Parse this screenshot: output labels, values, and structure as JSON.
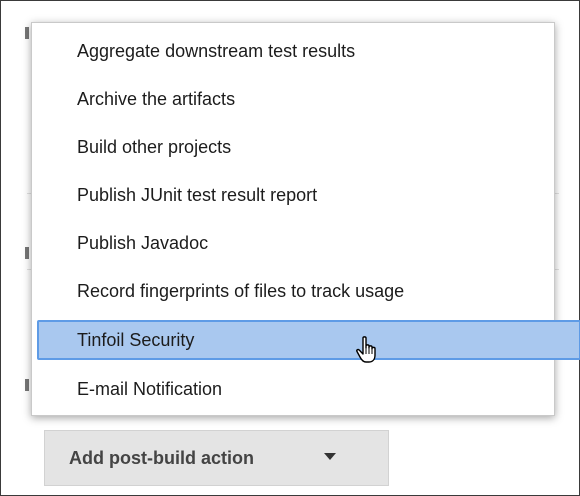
{
  "menu": {
    "items": [
      {
        "label": "Aggregate downstream test results"
      },
      {
        "label": "Archive the artifacts"
      },
      {
        "label": "Build other projects"
      },
      {
        "label": "Publish JUnit test result report"
      },
      {
        "label": "Publish Javadoc"
      },
      {
        "label": "Record fingerprints of files to track usage"
      },
      {
        "label": "Tinfoil Security",
        "selected": true
      },
      {
        "label": "E-mail Notification"
      }
    ]
  },
  "add_button": {
    "label": "Add post-build action",
    "icon": "chevron-down-icon"
  },
  "colors": {
    "selected_bg": "#a9c8ef",
    "selected_border": "#5e9be6",
    "button_bg": "#e4e4e4"
  }
}
